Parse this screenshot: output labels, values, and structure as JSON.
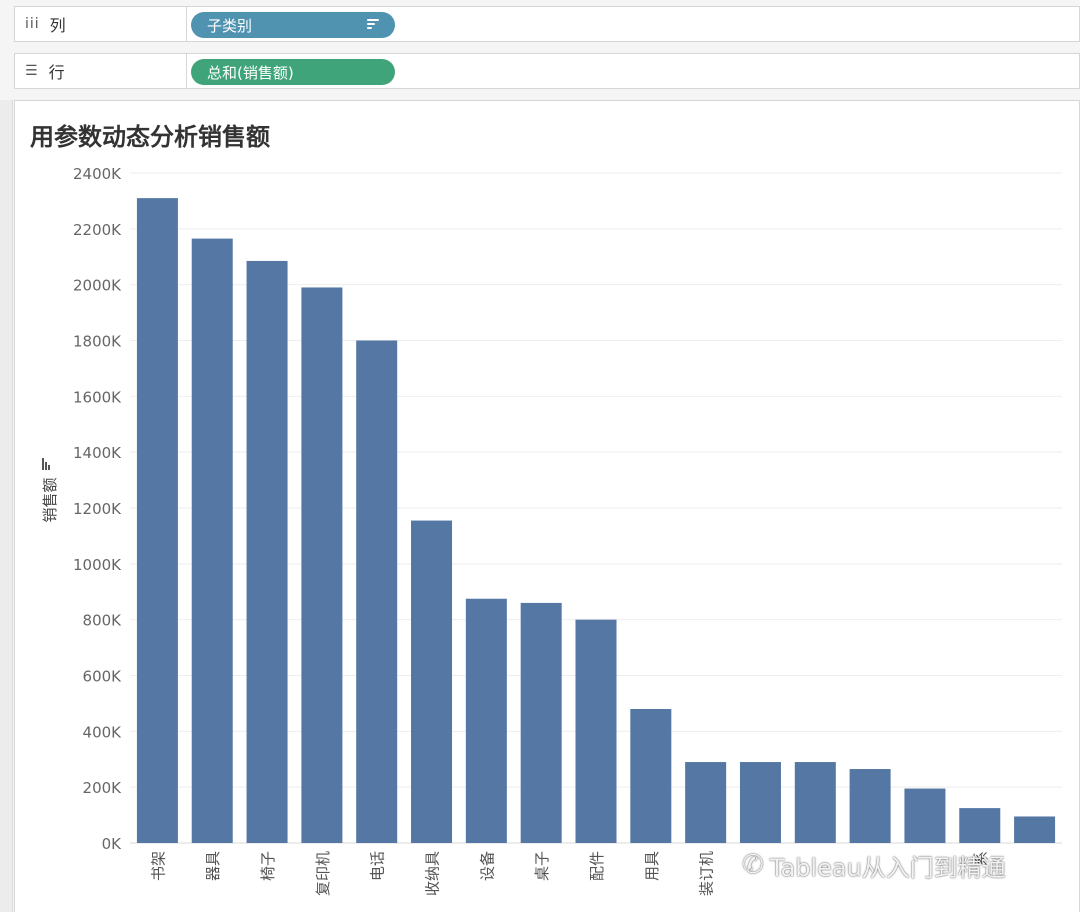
{
  "shelves": {
    "columns": {
      "label": "列",
      "icon": "columns-shelf-icon",
      "pill": "子类别",
      "pill_color": "#4f93b0",
      "sort_icon": "sort-descending-icon"
    },
    "rows": {
      "label": "行",
      "icon": "rows-shelf-icon",
      "pill": "总和(销售额)",
      "pill_color": "#3fa47a"
    }
  },
  "watermark": {
    "icon": "wechat-icon",
    "text": "Tableau从入门到精通"
  },
  "chart_data": {
    "type": "bar",
    "title": "用参数动态分析销售额",
    "ylabel": "销售额",
    "ylabel_icon": "sort-descending-icon",
    "xlabel": "",
    "ylim": [
      0,
      2400
    ],
    "yticks": [
      0,
      200,
      400,
      600,
      800,
      1000,
      1200,
      1400,
      1600,
      1800,
      2000,
      2200,
      2400
    ],
    "ytick_labels": [
      "0K",
      "200K",
      "400K",
      "600K",
      "800K",
      "1000K",
      "1200K",
      "1400K",
      "1600K",
      "1800K",
      "2000K",
      "2200K",
      "2400K"
    ],
    "categories": [
      "书架",
      "器具",
      "椅子",
      "复印机",
      "电话",
      "收纳具",
      "设备",
      "桌子",
      "配件",
      "用具",
      "装订机",
      "",
      "",
      "",
      "",
      "系",
      ""
    ],
    "values": [
      2310,
      2165,
      2085,
      1990,
      1800,
      1155,
      875,
      860,
      800,
      480,
      290,
      290,
      290,
      265,
      195,
      125,
      95
    ],
    "bar_color": "#5577a3",
    "gridlines": true
  }
}
